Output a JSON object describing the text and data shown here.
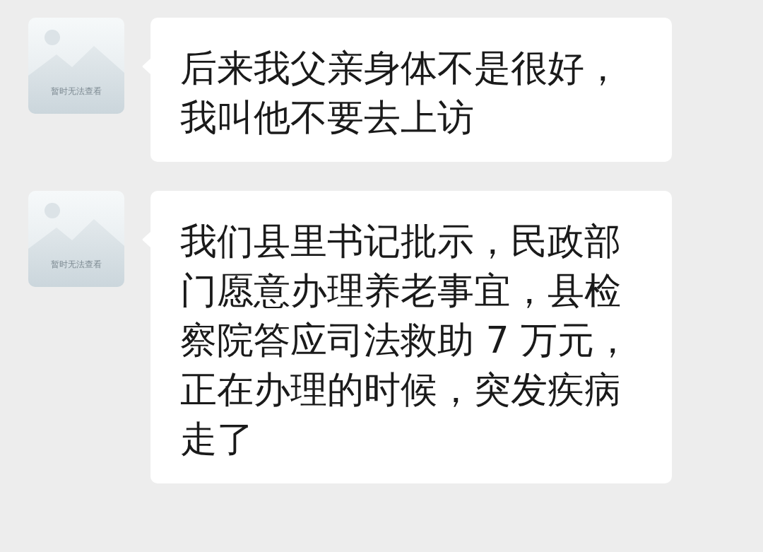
{
  "messages": [
    {
      "avatar": {
        "kind": "picture",
        "placeholder_text": "暂时无法查看"
      },
      "text": "后来我父亲身体不是很好，我叫他不要去上访"
    },
    {
      "avatar": {
        "kind": "picture",
        "placeholder_text": "暂时无法查看"
      },
      "text": "我们县里书记批示，民政部门愿意办理养老事宜，县检察院答应司法救助 7 万元，正在办理的时候，突发疾病走了"
    }
  ]
}
